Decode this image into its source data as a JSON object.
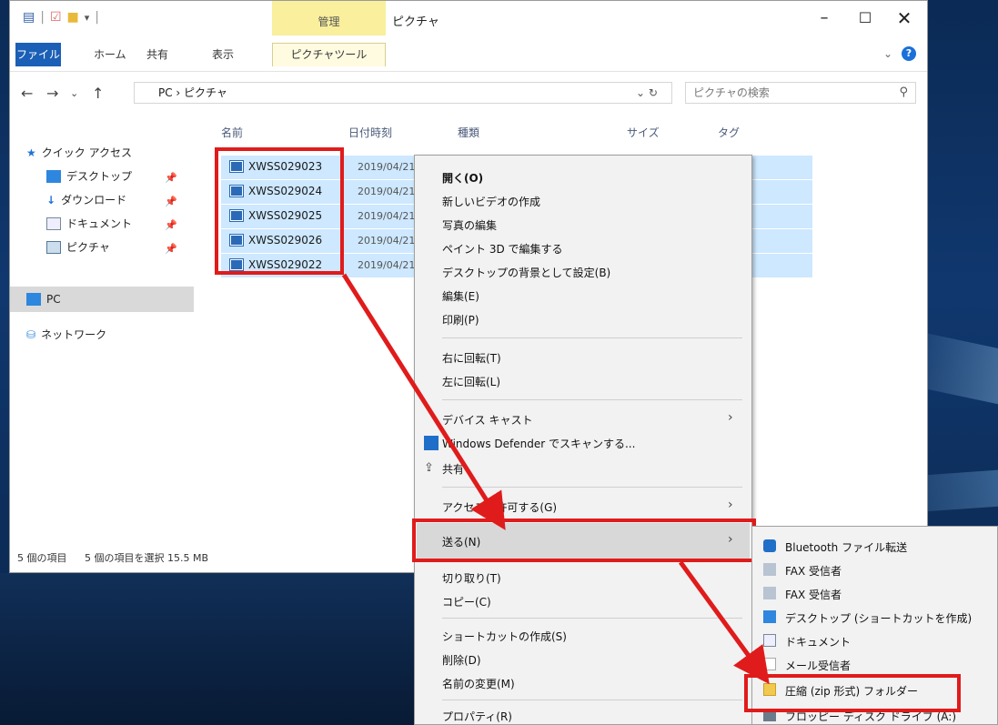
{
  "window": {
    "title": "ピクチャ",
    "context_tab_group": "管理",
    "tabs": {
      "file": "ファイル",
      "home": "ホーム",
      "share": "共有",
      "view": "表示",
      "context": "ピクチャツール"
    }
  },
  "address": {
    "path": "PC › ピクチャ",
    "search_placeholder": "ピクチャの検索"
  },
  "columns": {
    "name": "名前",
    "date": "日付時刻",
    "type": "種類",
    "size": "サイズ",
    "tag": "タグ"
  },
  "nav": {
    "quick_access": "クイック アクセス",
    "items": [
      "デスクトップ",
      "ダウンロード",
      "ドキュメント",
      "ピクチャ"
    ],
    "pc": "PC",
    "network": "ネットワーク"
  },
  "files": [
    {
      "name": "XWSS029023",
      "date": "2019/04/21"
    },
    {
      "name": "XWSS029024",
      "date": "2019/04/21"
    },
    {
      "name": "XWSS029025",
      "date": "2019/04/21"
    },
    {
      "name": "XWSS029026",
      "date": "2019/04/21"
    },
    {
      "name": "XWSS029022",
      "date": "2019/04/21"
    }
  ],
  "status": {
    "count": "5 個の項目",
    "selected": "5 個の項目を選択 15.5 MB"
  },
  "menu": {
    "open": "開く(O)",
    "new_video": "新しいビデオの作成",
    "edit_photo": "写真の編集",
    "paint3d": "ペイント 3D で編集する",
    "set_bg": "デスクトップの背景として設定(B)",
    "edit": "編集(E)",
    "print": "印刷(P)",
    "rotate_right": "右に回転(T)",
    "rotate_left": "左に回転(L)",
    "cast": "デバイス キャスト",
    "defender": "Windows Defender でスキャンする...",
    "share": "共有",
    "give_access": "アクセスを許可する(G)",
    "send_to": "送る(N)",
    "cut": "切り取り(T)",
    "copy": "コピー(C)",
    "shortcut": "ショートカットの作成(S)",
    "delete": "削除(D)",
    "rename": "名前の変更(M)",
    "properties": "プロパティ(R)"
  },
  "submenu": {
    "bluetooth": "Bluetooth ファイル転送",
    "fax1": "FAX 受信者",
    "fax2": "FAX 受信者",
    "desktop": "デスクトップ (ショートカットを作成)",
    "documents": "ドキュメント",
    "mail": "メール受信者",
    "zip": "圧縮 (zip 形式) フォルダー",
    "floppy": "フロッピー ディスク ドライブ (A:)"
  },
  "colors": {
    "accent": "#1b5fb6",
    "selection": "#cde8ff",
    "annotation": "#e01b1b",
    "context_tab": "#f9ef9d"
  }
}
